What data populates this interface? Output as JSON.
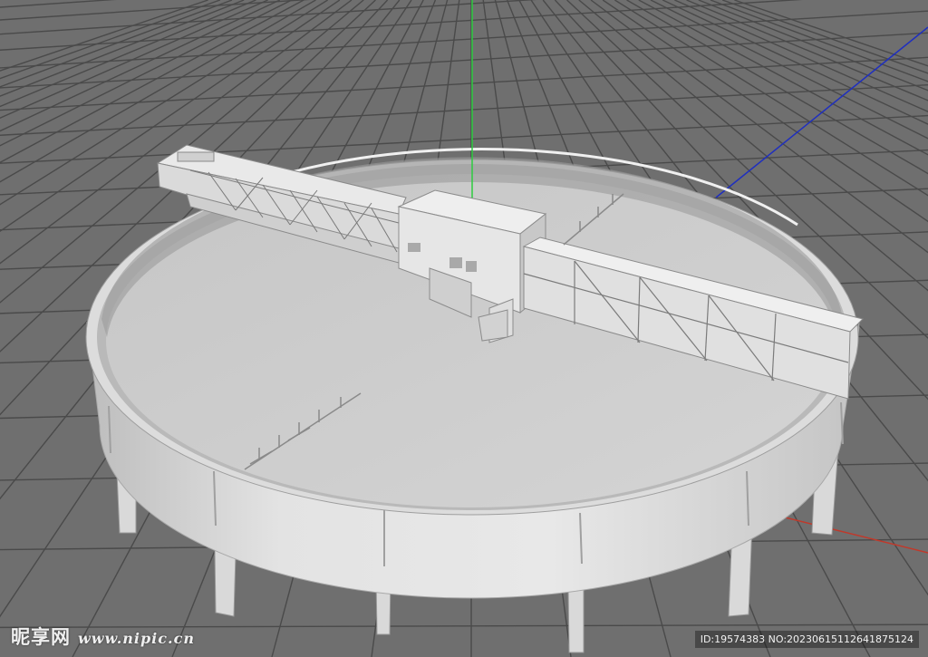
{
  "viewport": {
    "background": "#6f6f6f",
    "grid_color": "#4a4a4a",
    "axis_colors": {
      "x": "#c0392b",
      "y": "#2ecc40",
      "z": "#1f2fbf"
    }
  },
  "model": {
    "subject": "circular-clarifier-tank-with-bridge",
    "surface_color": "#d6d6d6"
  },
  "watermark": {
    "brand": "昵享网",
    "site": "www.nipic.cn",
    "id_line": "ID:19574383 NO:20230615112641875124"
  }
}
